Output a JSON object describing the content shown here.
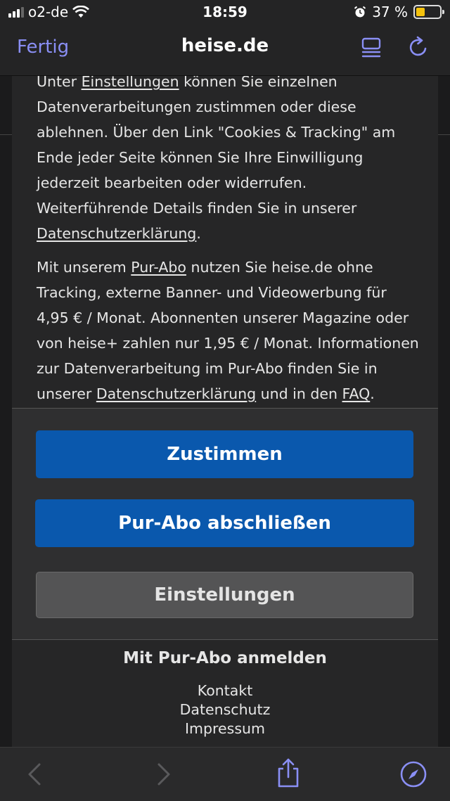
{
  "status_bar": {
    "carrier": "o2-de",
    "time": "18:59",
    "battery": "37 %",
    "battery_level": 0.37
  },
  "navbar": {
    "done_label": "Fertig",
    "title": "heise.de"
  },
  "consent": {
    "para1": {
      "t1": "Unter ",
      "link1": "Einstellungen",
      "t2": " können Sie einzelnen Datenverarbeitungen zustimmen oder diese ablehnen. Über den Link \"Cookies & Tracking\" am Ende jeder Seite können Sie Ihre Einwilligung jederzeit bearbeiten oder widerrufen. Weiterführende Details finden Sie in unserer ",
      "link2": "Datenschutzerklärung",
      "t3": "."
    },
    "para2": {
      "t1": "Mit unserem ",
      "link1": "Pur-Abo",
      "t2": " nutzen Sie heise.de ohne Tracking, externe Banner- und Videowerbung für 4,95 € / Monat. Abonnenten unserer Magazine oder von heise+ zahlen nur 1,95 € / Monat. Informationen zur Datenverarbeitung im Pur-Abo finden Sie in unserer ",
      "link2": "Datenschutzerklärung",
      "t3": " und in den ",
      "link3": "FAQ",
      "t4": "."
    },
    "buttons": {
      "accept": "Zustimmen",
      "subscribe": "Pur-Abo abschließen",
      "settings": "Einstellungen"
    },
    "footer": {
      "login": "Mit Pur-Abo anmelden",
      "contact": "Kontakt",
      "privacy": "Datenschutz",
      "imprint": "Impressum"
    }
  },
  "toolbar": {
    "icons": [
      "back-icon",
      "forward-icon",
      "share-icon",
      "compass-icon"
    ]
  },
  "colors": {
    "accent": "#8a8ff5",
    "primary_button": "#0a58ad",
    "secondary_button": "#545455",
    "battery": "#f4c20d"
  }
}
